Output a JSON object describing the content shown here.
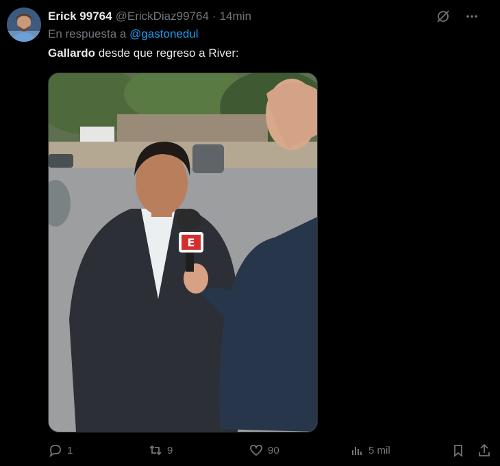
{
  "tweet": {
    "author_name": "Erick 99764",
    "author_handle": "@ErickDiaz99764",
    "separator": "·",
    "time": "14min",
    "reply_prefix": "En respuesta a",
    "reply_mention": "@gastonedul",
    "text_bold": "Gallardo",
    "text_rest": " desde que regreso a River:",
    "media_icon": "photo",
    "media_logo_text": "E"
  },
  "actions": {
    "replies": "1",
    "reposts": "9",
    "likes": "90",
    "views": "5 mil"
  },
  "icons": {
    "grok": "grok-icon",
    "more": "more-icon",
    "reply": "reply-icon",
    "repost": "repost-icon",
    "like": "heart-icon",
    "views": "views-icon",
    "bookmark": "bookmark-icon",
    "share": "share-icon"
  },
  "colors": {
    "background": "#000000",
    "text_primary": "#e7e9ea",
    "text_secondary": "#71767b",
    "accent": "#1d9bf0"
  }
}
